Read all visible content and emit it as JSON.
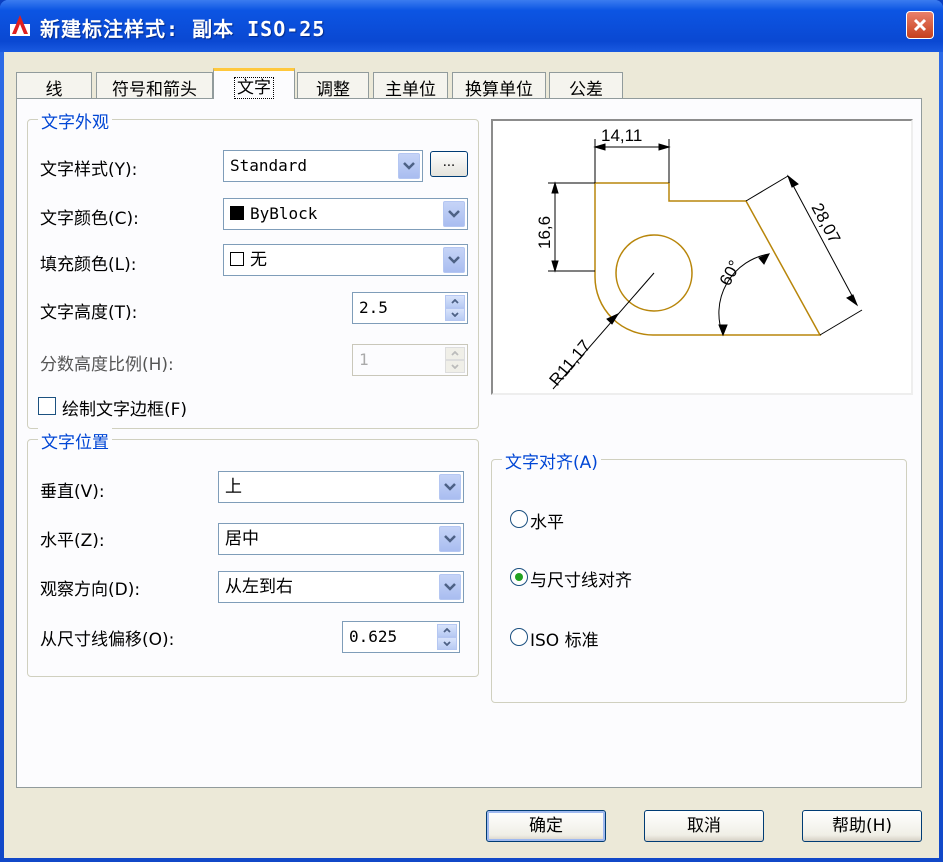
{
  "window": {
    "title": "新建标注样式: 副本 ISO-25"
  },
  "tabs": [
    {
      "label": "线"
    },
    {
      "label": "符号和箭头"
    },
    {
      "label": "文字"
    },
    {
      "label": "调整"
    },
    {
      "label": "主单位"
    },
    {
      "label": "换算单位"
    },
    {
      "label": "公差"
    }
  ],
  "active_tab": "文字",
  "appearance": {
    "title": "文字外观",
    "text_style_label": "文字样式(Y):",
    "text_style_value": "Standard",
    "browse_label": "...",
    "text_color_label": "文字颜色(C):",
    "text_color_value": "ByBlock",
    "fill_color_label": "填充颜色(L):",
    "fill_color_value": "无",
    "text_height_label": "文字高度(T):",
    "text_height_value": "2.5",
    "fraction_scale_label": "分数高度比例(H):",
    "fraction_scale_value": "1",
    "draw_frame_label": "绘制文字边框(F)",
    "draw_frame_checked": false
  },
  "placement": {
    "title": "文字位置",
    "vertical_label": "垂直(V):",
    "vertical_value": "上",
    "horizontal_label": "水平(Z):",
    "horizontal_value": "居中",
    "view_direction_label": "观察方向(D):",
    "view_direction_value": "从左到右",
    "offset_label": "从尺寸线偏移(O):",
    "offset_value": "0.625"
  },
  "preview": {
    "dim_top": "14,11",
    "dim_left": "16,6",
    "dim_right": "28,07",
    "angle": "60°",
    "radius": "R11,17"
  },
  "alignment": {
    "title": "文字对齐(A)",
    "options": [
      {
        "label": "水平",
        "selected": false
      },
      {
        "label": "与尺寸线对齐",
        "selected": true
      },
      {
        "label": "ISO 标准",
        "selected": false
      }
    ]
  },
  "buttons": {
    "ok": "确定",
    "cancel": "取消",
    "help": "帮助(H)"
  },
  "colors": {
    "accent": "#0046d5",
    "shape": "#b8860b",
    "radio_dot": "#21a121"
  }
}
